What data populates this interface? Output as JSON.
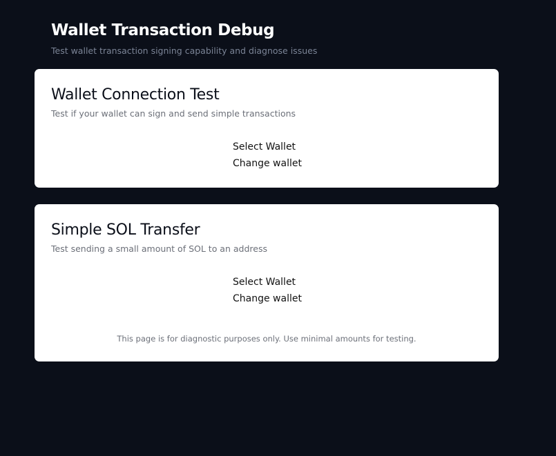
{
  "header": {
    "title": "Wallet Transaction Debug",
    "subtitle": "Test wallet transaction signing capability and diagnose issues"
  },
  "cards": [
    {
      "title": "Wallet Connection Test",
      "description": "Test if your wallet can sign and send simple transactions",
      "select_wallet_label": "Select Wallet",
      "change_wallet_label": "Change wallet"
    },
    {
      "title": "Simple SOL Transfer",
      "description": "Test sending a small amount of SOL to an address",
      "select_wallet_label": "Select Wallet",
      "change_wallet_label": "Change wallet",
      "note": "This page is for diagnostic purposes only. Use minimal amounts for testing."
    }
  ],
  "colors": {
    "background": "#0b0f19",
    "card": "#ffffff",
    "muted_text": "#6b6f78"
  }
}
